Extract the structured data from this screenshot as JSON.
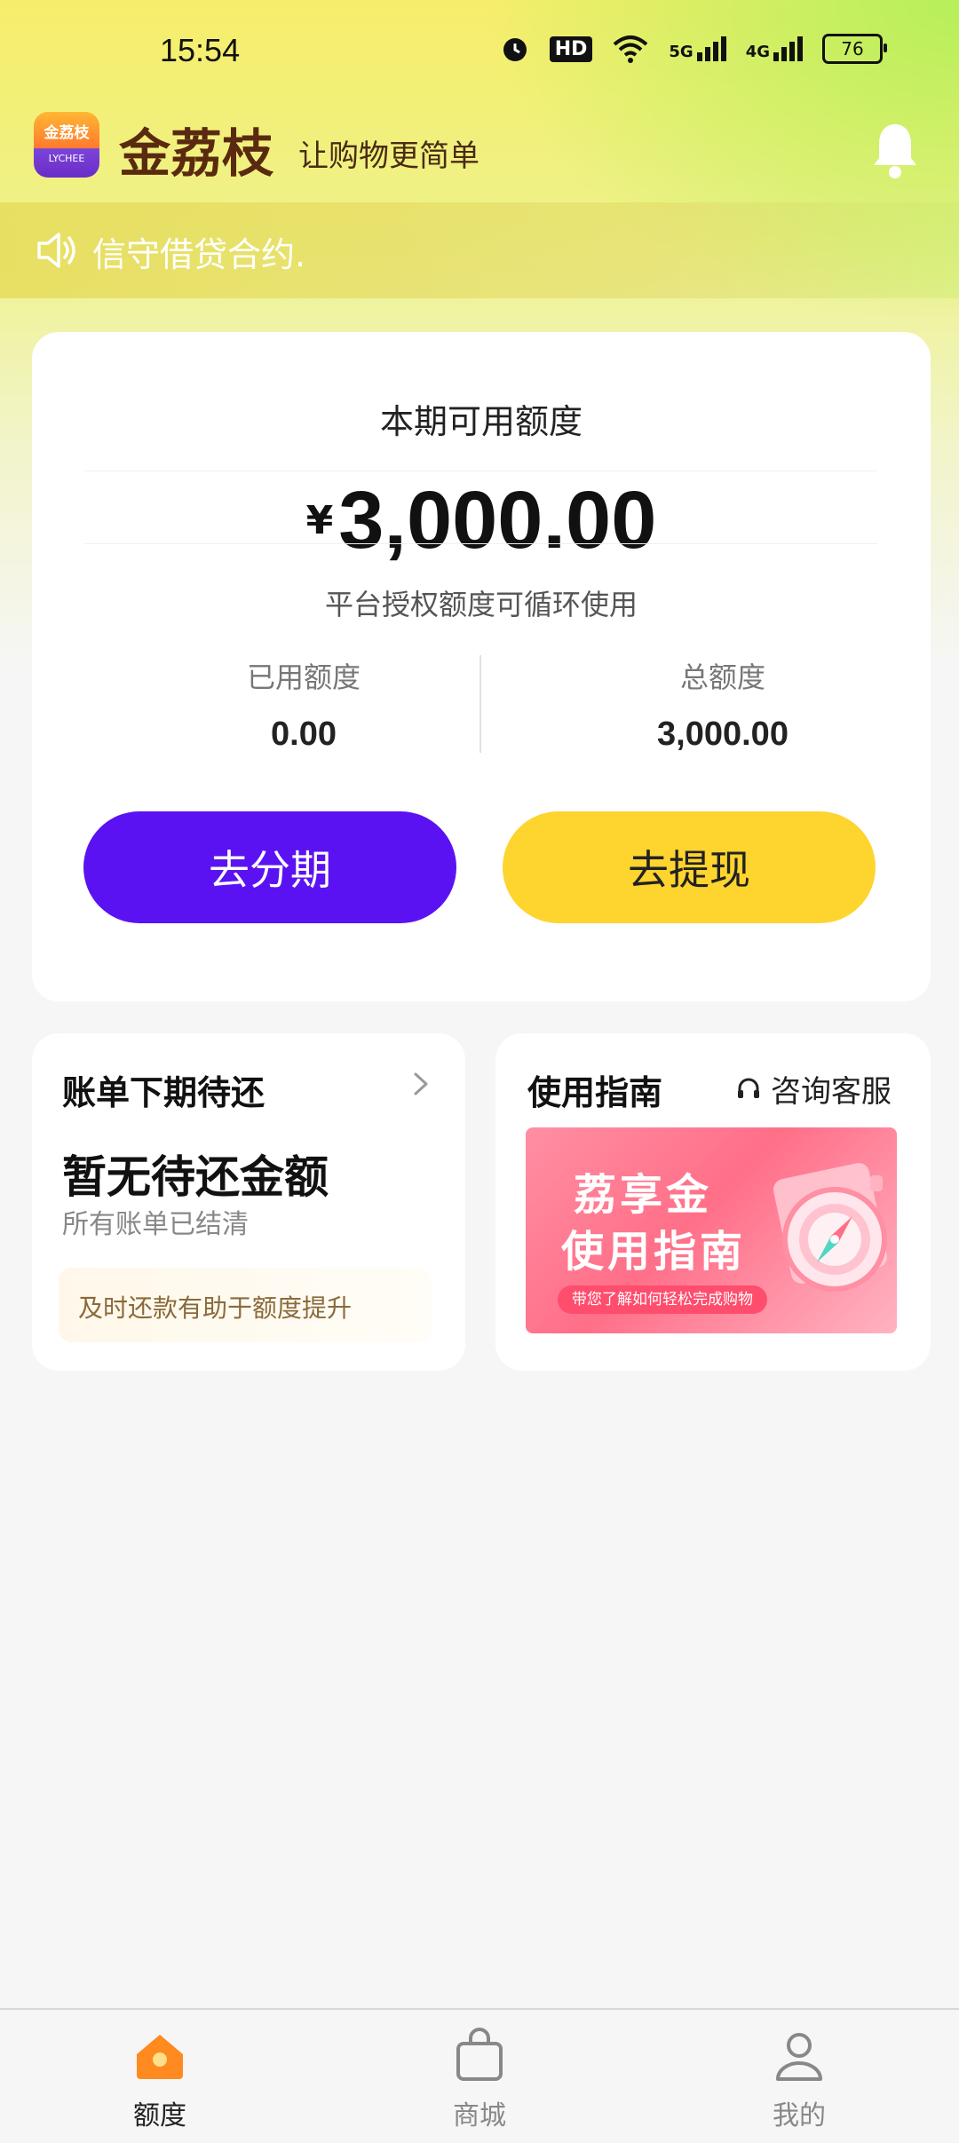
{
  "status_bar": {
    "time": "15:54",
    "hd_label": "HD",
    "net1": "5G",
    "net2": "4G",
    "battery": "76"
  },
  "header": {
    "logo_text": "金荔枝",
    "logo_sub": "LYCHEE",
    "brand": "金荔枝",
    "slogan": "让购物更简单"
  },
  "notice": {
    "text": "信守借贷合约."
  },
  "quota": {
    "title": "本期可用额度",
    "currency": "¥",
    "amount": "3,000.00",
    "subtitle": "平台授权额度可循环使用",
    "used_label": "已用额度",
    "used_value": "0.00",
    "total_label": "总额度",
    "total_value": "3,000.00",
    "installment_button": "去分期",
    "withdraw_button": "去提现"
  },
  "bill": {
    "title": "账单下期待还",
    "main": "暂无待还金额",
    "sub": "所有账单已结清",
    "tip": "及时还款有助于额度提升"
  },
  "guide": {
    "title": "使用指南",
    "customer_service": "咨询客服",
    "banner_line1": "荔享金",
    "banner_line2": "使用指南",
    "banner_pill": "带您了解如何轻松完成购物"
  },
  "tabbar": {
    "items": [
      {
        "label": "额度"
      },
      {
        "label": "商城"
      },
      {
        "label": "我的"
      }
    ]
  },
  "colors": {
    "primary_button": "#5b12f2",
    "secondary_button": "#fed42e",
    "brand_brown": "#5a2a10",
    "active_tab_icon": "#ff8a1f"
  },
  "icons": [
    "alarm-icon",
    "wifi-icon",
    "signal-icon",
    "battery-icon",
    "bell-icon",
    "speaker-icon",
    "chevron-right-icon",
    "headset-icon",
    "home-icon",
    "shopping-bag-icon",
    "user-icon"
  ]
}
